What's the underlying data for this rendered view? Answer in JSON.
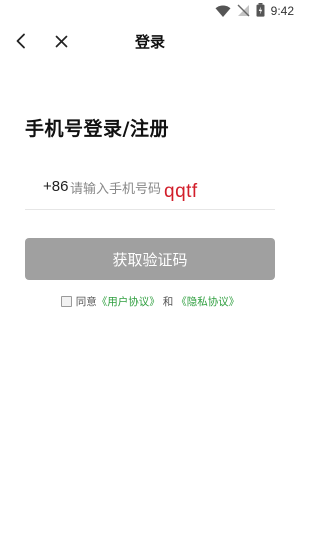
{
  "status_bar": {
    "time": "9:42",
    "icons": [
      "wifi-icon",
      "no-signal-icon",
      "battery-icon"
    ]
  },
  "nav": {
    "title": "登录",
    "back_icon": "back-chevron-icon",
    "close_icon": "close-icon"
  },
  "heading": "手机号登录/注册",
  "phone": {
    "country_code": "+86",
    "placeholder": "请输入手机号码",
    "handwritten_overlay": "qqtf"
  },
  "submit_label": "获取验证码",
  "agreement": {
    "prefix": "同意",
    "user_agreement": "《用户协议》",
    "and": "和",
    "privacy_policy": "《隐私协议》"
  },
  "colors": {
    "button_disabled": "#a0a0a0",
    "link": "#2e9e3e",
    "handwriting": "#d21e2a"
  }
}
